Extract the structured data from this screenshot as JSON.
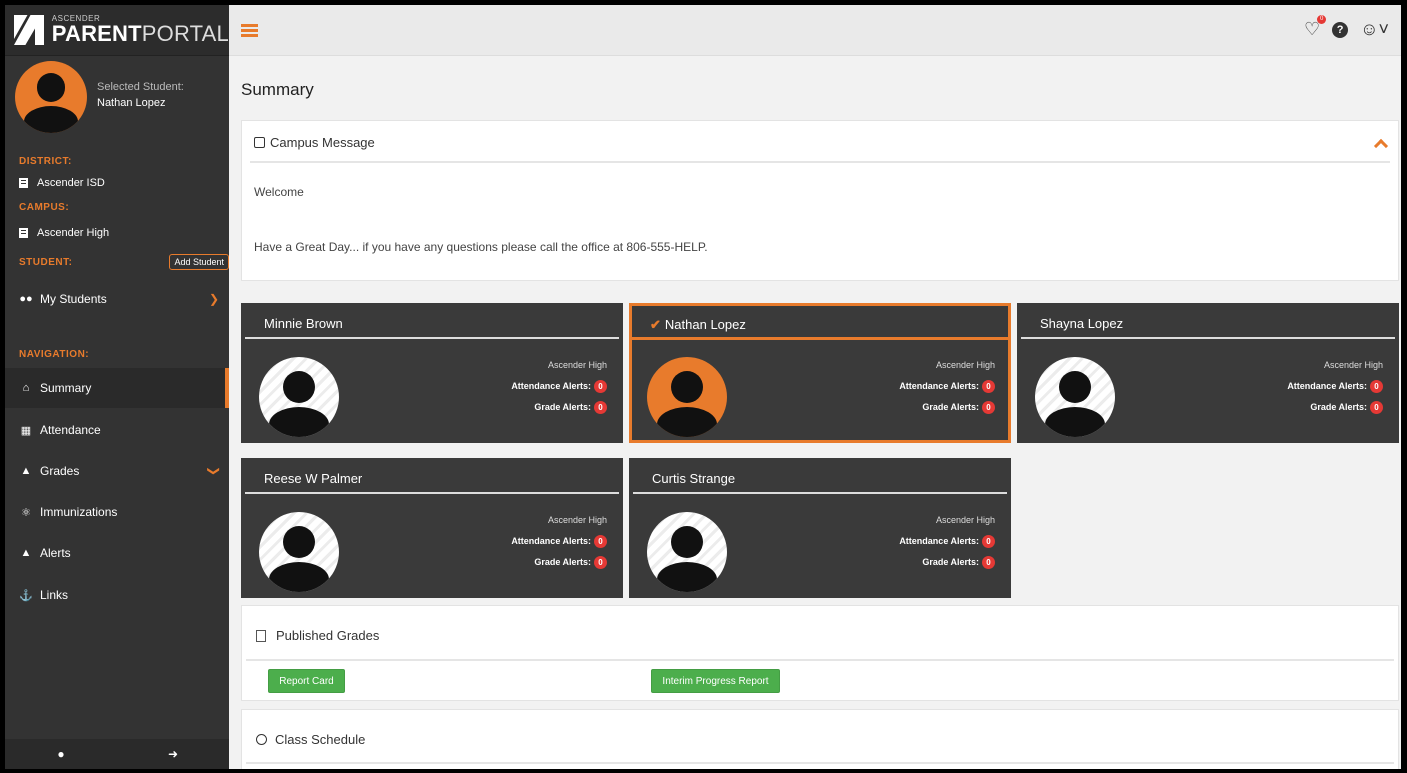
{
  "logo": {
    "small": "ASCENDER",
    "bold": "PARENT",
    "light": "PORTAL"
  },
  "selected_student": {
    "label": "Selected Student:",
    "name": "Nathan Lopez"
  },
  "sidebar": {
    "district_heading": "DISTRICT:",
    "district": "Ascender ISD",
    "campus_heading": "CAMPUS:",
    "campus": "Ascender High",
    "student_heading": "STUDENT:",
    "add_student": "Add Student",
    "my_students": "My Students",
    "navigation_heading": "NAVIGATION:",
    "nav": [
      {
        "label": "Summary",
        "icon": "home-icon"
      },
      {
        "label": "Attendance",
        "icon": "calendar-icon"
      },
      {
        "label": "Grades",
        "icon": "graduation-cap-icon"
      },
      {
        "label": "Immunizations",
        "icon": "medical-icon"
      },
      {
        "label": "Alerts",
        "icon": "bell-icon"
      },
      {
        "label": "Links",
        "icon": "anchor-icon"
      }
    ]
  },
  "topbar": {
    "notification_count": "0"
  },
  "main": {
    "title": "Summary",
    "campus_message": {
      "heading": "Campus Message",
      "welcome": "Welcome",
      "message": "Have a Great Day... if you have any questions please call the office at 806-555-HELP."
    },
    "students": [
      {
        "name": "Minnie Brown",
        "campus": "Ascender High",
        "attendance_label": "Attendance Alerts:",
        "attendance": "0",
        "grade_label": "Grade Alerts:",
        "grades": "0",
        "selected": false
      },
      {
        "name": "Nathan Lopez",
        "campus": "Ascender High",
        "attendance_label": "Attendance Alerts:",
        "attendance": "0",
        "grade_label": "Grade Alerts:",
        "grades": "0",
        "selected": true
      },
      {
        "name": "Shayna Lopez",
        "campus": "Ascender High",
        "attendance_label": "Attendance Alerts:",
        "attendance": "0",
        "grade_label": "Grade Alerts:",
        "grades": "0",
        "selected": false
      },
      {
        "name": "Reese W Palmer",
        "campus": "Ascender High",
        "attendance_label": "Attendance Alerts:",
        "attendance": "0",
        "grade_label": "Grade Alerts:",
        "grades": "0",
        "selected": false
      },
      {
        "name": "Curtis Strange",
        "campus": "Ascender High",
        "attendance_label": "Attendance Alerts:",
        "attendance": "0",
        "grade_label": "Grade Alerts:",
        "grades": "0",
        "selected": false
      }
    ],
    "published_grades": {
      "heading": "Published Grades",
      "report_card": "Report Card",
      "interim": "Interim Progress Report"
    },
    "class_schedule": {
      "heading": "Class Schedule"
    }
  },
  "colors": {
    "accent": "#e87b2c",
    "sidebar": "#333333",
    "card": "#3a3a3a",
    "badge": "#e53935",
    "button": "#4cae4c"
  }
}
